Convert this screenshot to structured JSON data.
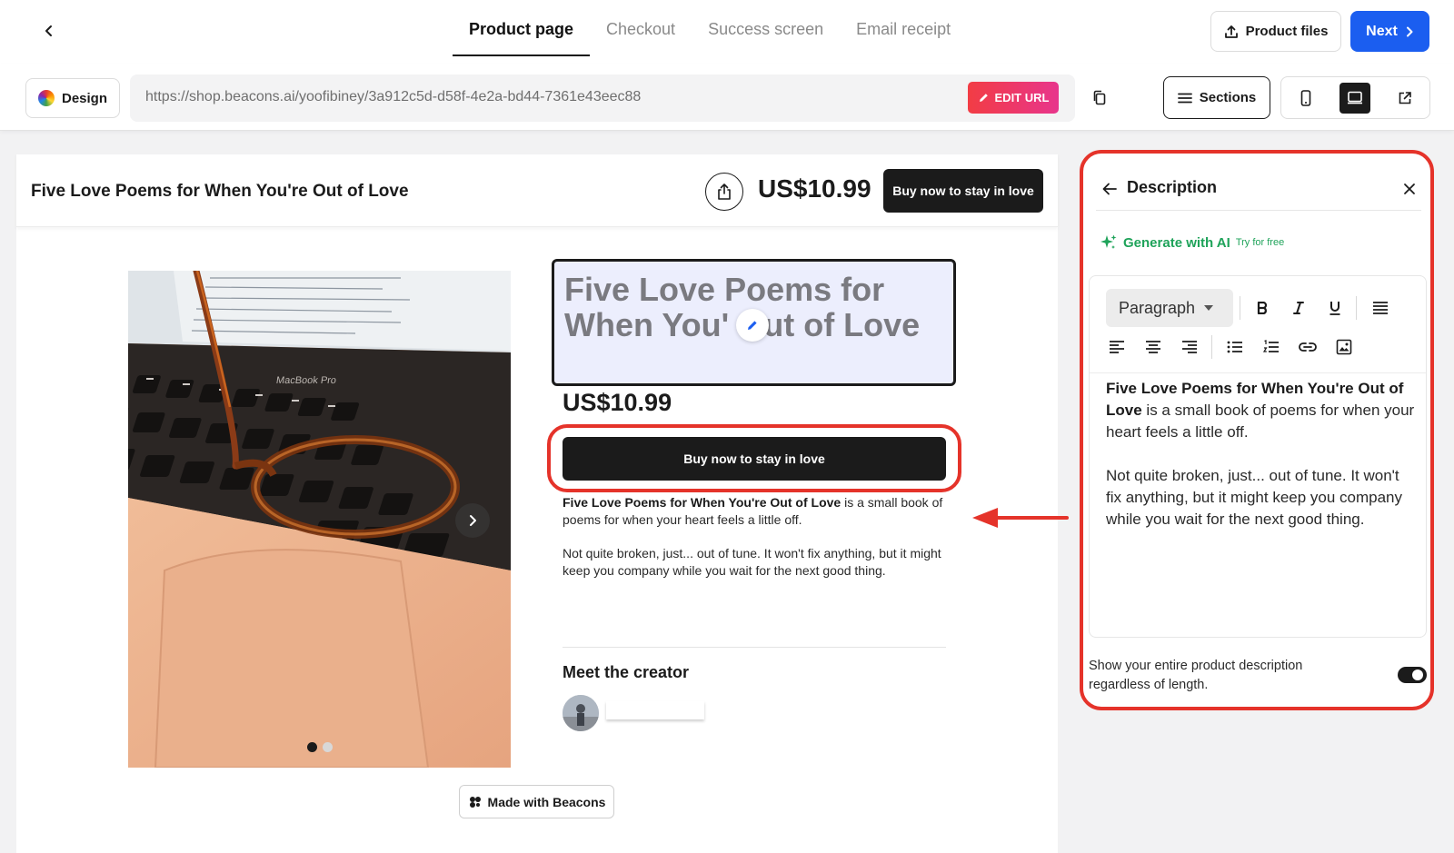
{
  "colors": {
    "accent_blue": "#1b5ef0",
    "annotation_red": "#e5332a",
    "ai_green": "#1fa35a",
    "dark": "#1b1b1b"
  },
  "nav": {
    "tabs": [
      {
        "label": "Product page",
        "active": true
      },
      {
        "label": "Checkout",
        "active": false
      },
      {
        "label": "Success screen",
        "active": false
      },
      {
        "label": "Email receipt",
        "active": false
      }
    ],
    "product_files_label": "Product files",
    "next_label": "Next"
  },
  "toolbar": {
    "design_label": "Design",
    "url": "https://shop.beacons.ai/yoofibiney/3a912c5d-d58f-4e2a-bd44-7361e43eec88",
    "edit_url_label": "EDIT URL",
    "sections_label": "Sections",
    "selected_device": "desktop"
  },
  "product": {
    "header_title": "Five Love Poems for When You're Out of Love",
    "price": "US$10.99",
    "buy_label": "Buy now to stay in love",
    "title": "Five Love Poems for When You' Out of Love",
    "desc_bold": "Five Love Poems for When You're Out of Love",
    "desc_rest": " is a small book of poems for when your heart feels a little off.",
    "desc_p2": "Not quite broken, just... out of tune. It won't fix anything, but it might keep you company while you wait for the next good thing.",
    "meet_creator": "Meet the creator",
    "made_with": "Made with Beacons",
    "image_slide": 1,
    "image_slides_total": 2
  },
  "panel": {
    "title": "Description",
    "generate_ai": "Generate with AI",
    "generate_ai_sub": "Try for free",
    "format_select": "Paragraph",
    "editor_bold": "Five Love Poems for When You're Out of Love",
    "editor_rest": " is a small book of poems for when your heart feels a little off.",
    "editor_p2": "Not quite broken, just... out of tune. It won't fix anything, but it might keep you company while you wait for the next good thing.",
    "toggle_label": "Show your entire product description regardless of length.",
    "toggle_on": true
  }
}
